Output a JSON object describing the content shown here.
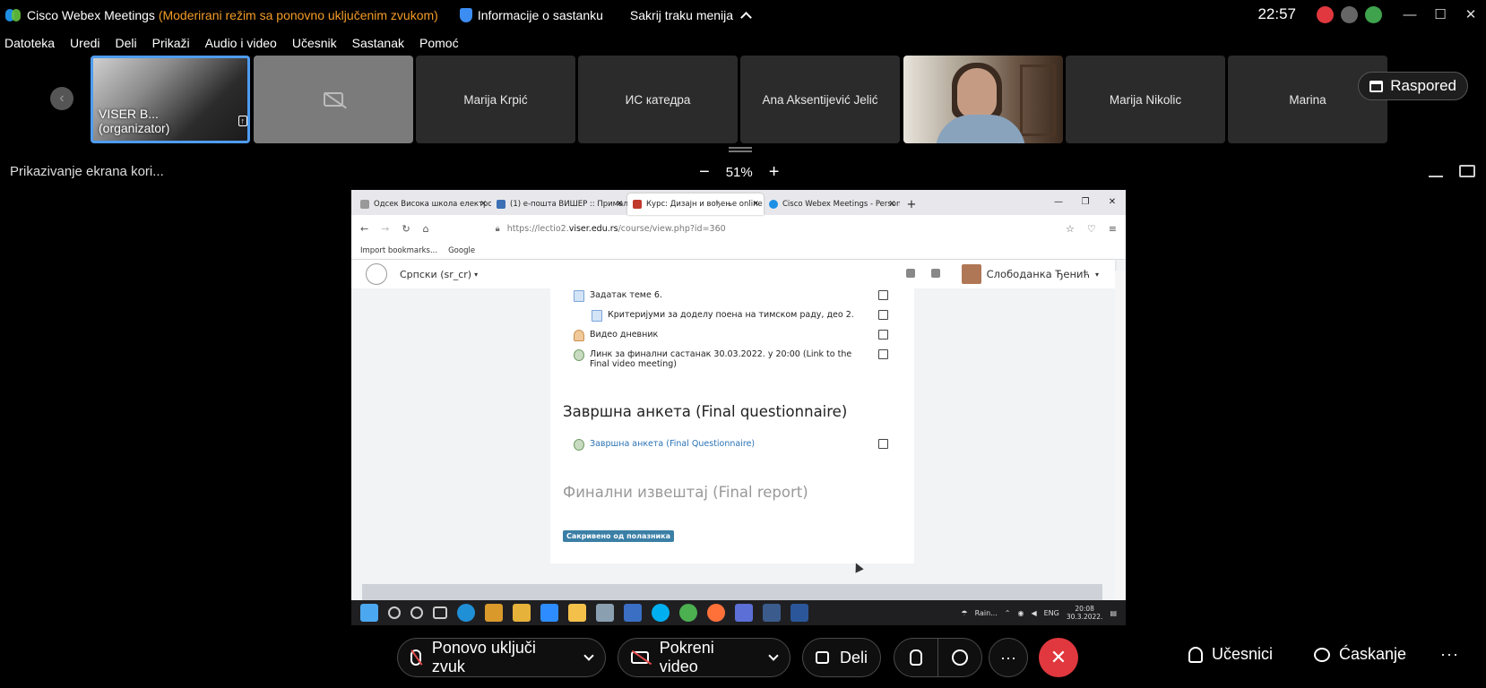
{
  "app": {
    "title": "Cisco Webex Meetings",
    "mode": "(Moderirani režim sa ponovno uključenim zvukom)",
    "meeting_info": "Informacije o sastanku",
    "hide_menu": "Sakrij traku menija",
    "time": "22:57",
    "colors": {
      "accent": "#4f9cf0",
      "warning": "#f39c27",
      "end": "#e0383e"
    }
  },
  "menubar": [
    "Datoteka",
    "Uredi",
    "Deli",
    "Prikaži",
    "Audio i video",
    "Učesnik",
    "Sastanak",
    "Pomoć"
  ],
  "participants": {
    "presenter_label": "VISER B... (organizator)",
    "tiles": [
      "Marija Krpić",
      "ИС катедра",
      "Ana Aksentijević Jelić",
      "Marija Nikolic",
      "Marina"
    ],
    "layout_button": "Raspored"
  },
  "share": {
    "label": "Prikazivanje ekrana kori...",
    "zoom": "51%",
    "zoom_out": "−",
    "zoom_in": "+"
  },
  "browser": {
    "tabs": [
      "Одсек Висока школа електро...",
      "(1) е-пошта ВИШЕР :: Прималн...",
      "Курс: Дизајн и вођење online ...",
      "Cisco Webex Meetings - Person..."
    ],
    "url_prefix": "https://lectio2.",
    "url_host": "viser.edu.rs",
    "url_path": "/course/view.php?id=360",
    "bookmarks": [
      "Import bookmarks...",
      "Google"
    ],
    "language": "Српски (sr_cr)",
    "user_name": "Слободанка Ђенић"
  },
  "course": {
    "activities": [
      "Задатак теме 6.",
      "Критеријуми за доделу поена на тимском раду, део 2.",
      "Видео дневник",
      "Линк за финални састанак 30.03.2022. у 20:00 (Link to the Final video meeting)"
    ],
    "section2_title": "Завршна анкета (Final questionnaire)",
    "section2_activity": "Завршна анкета (Final Questionnaire)",
    "section3_title": "Финални извештај (Final report)",
    "hidden_badge": "Сакривено од полазника"
  },
  "taskbar": {
    "weather": "Rain...",
    "lang": "ENG",
    "time": "20:08",
    "date": "30.3.2022."
  },
  "controls": {
    "unmute": "Ponovo uključi zvuk",
    "start_video": "Pokreni video",
    "share": "Deli",
    "more": "···",
    "end": "✕",
    "participants": "Učesnici",
    "chat": "Ćaskanje"
  }
}
